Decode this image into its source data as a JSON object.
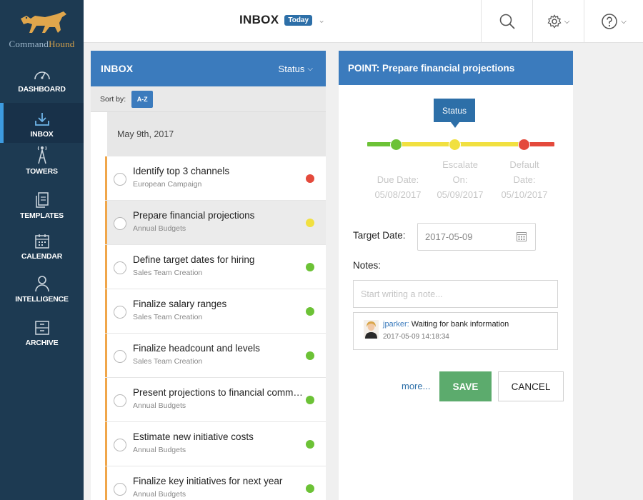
{
  "brand": {
    "prefix": "Command",
    "suffix": "Hound",
    "logo_icon": "hound-logo-icon"
  },
  "sidebar": {
    "items": [
      {
        "label": "DASHBOARD",
        "icon": "speedometer-icon"
      },
      {
        "label": "INBOX",
        "icon": "download-tray-icon",
        "active": true
      },
      {
        "label": "TOWERS",
        "icon": "tower-icon"
      },
      {
        "label": "TEMPLATES",
        "icon": "documents-icon"
      },
      {
        "label": "CALENDAR",
        "icon": "calendar-icon"
      },
      {
        "label": "INTELLIGENCE",
        "icon": "person-icon"
      },
      {
        "label": "ARCHIVE",
        "icon": "archive-box-icon"
      }
    ]
  },
  "topbar": {
    "title": "INBOX",
    "badge": "Today",
    "actions": [
      "search-icon",
      "gear-icon",
      "help-icon"
    ]
  },
  "list": {
    "header": "INBOX",
    "status_label": "Status",
    "sort_label": "Sort by:",
    "sort_button": "A-Z",
    "date_group": "May 9th, 2017",
    "items": [
      {
        "title": "Identify top 3 channels",
        "subtitle": "European Campaign",
        "status_color": "#e44a3c"
      },
      {
        "title": "Prepare financial projections",
        "subtitle": "Annual Budgets",
        "status_color": "#f1e040",
        "selected": true
      },
      {
        "title": "Define target dates for hiring",
        "subtitle": "Sales Team Creation",
        "status_color": "#6cc236"
      },
      {
        "title": "Finalize salary ranges",
        "subtitle": "Sales Team Creation",
        "status_color": "#6cc236"
      },
      {
        "title": "Finalize headcount and levels",
        "subtitle": "Sales Team Creation",
        "status_color": "#6cc236"
      },
      {
        "title": "Present projections to financial committee",
        "subtitle": "Annual Budgets",
        "status_color": "#6cc236"
      },
      {
        "title": "Estimate new initiative costs",
        "subtitle": "Annual Budgets",
        "status_color": "#6cc236"
      },
      {
        "title": "Finalize key initiatives for next year",
        "subtitle": "Annual Budgets",
        "status_color": "#6cc236"
      }
    ]
  },
  "point": {
    "header": "POINT: Prepare financial projections",
    "status_tooltip": "Status",
    "milestones": [
      {
        "label_line1": "Due Date:",
        "date": "05/08/2017",
        "color": "#6cc236"
      },
      {
        "label_line1": "Escalate",
        "label_line2": "On:",
        "date": "05/09/2017",
        "color": "#f1e040"
      },
      {
        "label_line1": "Default",
        "label_line2": "Date:",
        "date": "05/10/2017",
        "color": "#e44a3c"
      }
    ],
    "target_date_label": "Target Date:",
    "target_date_value": "2017-05-09",
    "notes_label": "Notes:",
    "note_placeholder": "Start writing a note...",
    "note": {
      "user": "jparker:",
      "text": "Waiting for bank information",
      "timestamp": "2017-05-09 14:18:34"
    },
    "more_label": "more...",
    "save_label": "SAVE",
    "cancel_label": "CANCEL"
  }
}
